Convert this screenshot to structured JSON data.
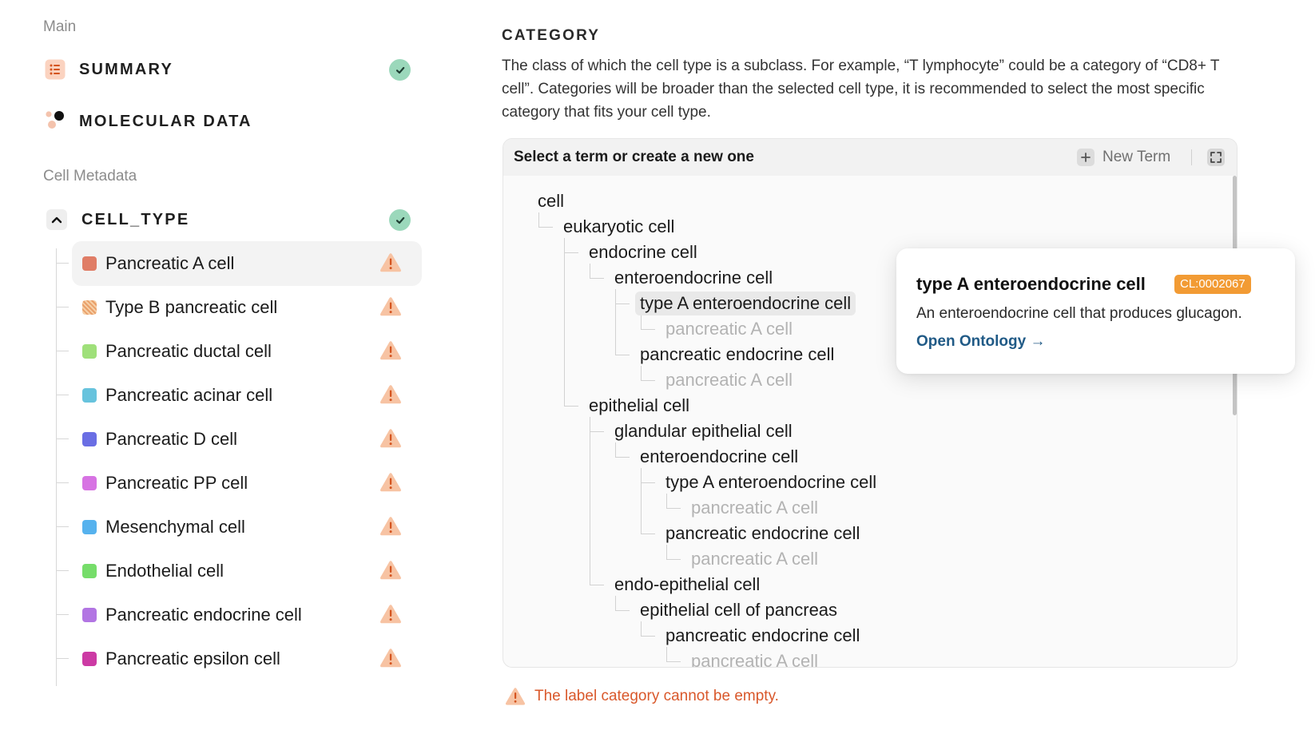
{
  "sidebar": {
    "main_label": "Main",
    "summary": {
      "label": "SUMMARY",
      "icon": "list-icon",
      "status": "complete"
    },
    "molecular": {
      "label": "MOLECULAR DATA",
      "icon": "molecule-icon"
    },
    "metadata_label": "Cell Metadata",
    "cell_type": {
      "label": "CELL_TYPE",
      "expanded": true,
      "status": "complete"
    },
    "cells": [
      {
        "label": "Pancreatic A cell",
        "color": "#e07d66",
        "status": "warning",
        "active": true
      },
      {
        "label": "Type B pancreatic cell",
        "color": "#e9a06a",
        "pattern": "hatched",
        "status": "warning"
      },
      {
        "label": "Pancreatic ductal cell",
        "color": "#9fe07a",
        "status": "warning"
      },
      {
        "label": "Pancreatic acinar cell",
        "color": "#67c3dd",
        "status": "warning"
      },
      {
        "label": "Pancreatic D cell",
        "color": "#6a6ee4",
        "status": "warning"
      },
      {
        "label": "Pancreatic PP cell",
        "color": "#d773e3",
        "status": "warning"
      },
      {
        "label": "Mesenchymal cell",
        "color": "#56b2ee",
        "status": "warning"
      },
      {
        "label": "Endothelial cell",
        "color": "#76dd6a",
        "status": "warning"
      },
      {
        "label": "Pancreatic endocrine cell",
        "color": "#b275e3",
        "status": "warning"
      },
      {
        "label": "Pancreatic epsilon cell",
        "color": "#cc3aa4",
        "status": "warning"
      }
    ]
  },
  "main": {
    "heading": "CATEGORY",
    "description": "The class of which the cell type is a subclass. For example, “T lymphocyte” could be a category of “CD8+ T cell”. Categories will be broader than the selected cell type, it is recommended to select the most specific category that fits your cell type.",
    "picker": {
      "title": "Select a term or create a new one",
      "new_term_label": "New Term",
      "tree": [
        {
          "label": "cell",
          "level": 0
        },
        {
          "label": "eukaryotic cell",
          "level": 1
        },
        {
          "label": "endocrine cell",
          "level": 2
        },
        {
          "label": "enteroendocrine cell",
          "level": 3
        },
        {
          "label": "type A enteroendocrine cell",
          "level": 4,
          "selected": true
        },
        {
          "label": "pancreatic A cell",
          "level": 5,
          "muted": true
        },
        {
          "label": "pancreatic endocrine cell",
          "level": 4
        },
        {
          "label": "pancreatic A cell",
          "level": 5,
          "muted": true
        },
        {
          "label": "epithelial cell",
          "level": 2
        },
        {
          "label": "glandular epithelial cell",
          "level": 3
        },
        {
          "label": "enteroendocrine cell",
          "level": 4
        },
        {
          "label": "type A enteroendocrine cell",
          "level": 5
        },
        {
          "label": "pancreatic A cell",
          "level": 6,
          "muted": true
        },
        {
          "label": "pancreatic endocrine cell",
          "level": 5
        },
        {
          "label": "pancreatic A cell",
          "level": 6,
          "muted": true
        },
        {
          "label": "endo-epithelial cell",
          "level": 3
        },
        {
          "label": "epithelial cell of pancreas",
          "level": 4
        },
        {
          "label": "pancreatic endocrine cell",
          "level": 5
        },
        {
          "label": "pancreatic A cell",
          "level": 6,
          "muted": true
        }
      ]
    },
    "error": "The label category cannot be empty."
  },
  "tooltip": {
    "title": "type A enteroendocrine cell",
    "badge": "CL:0002067",
    "description": "An enteroendocrine cell that produces glucagon.",
    "link": "Open Ontology →"
  },
  "colors": {
    "success": "#9bd8bb",
    "warning": "#f7c3a3",
    "warning_mark": "#d4541f",
    "error_text": "#d9582b",
    "badge": "#f29b34",
    "link": "#205a86"
  }
}
